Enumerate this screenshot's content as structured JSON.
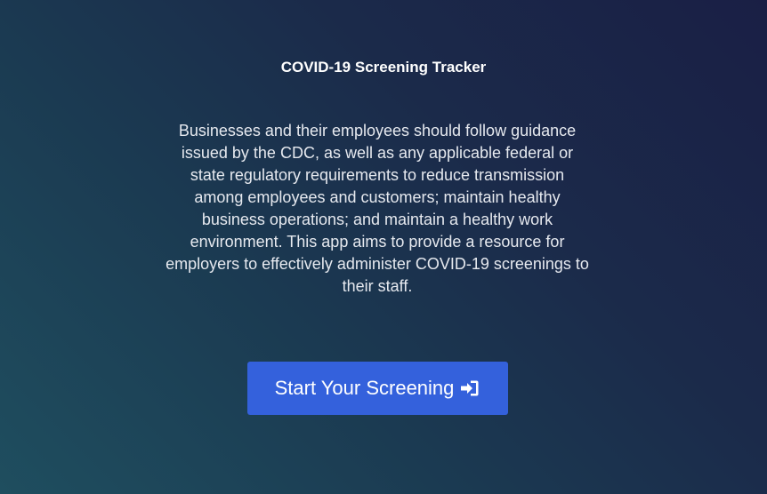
{
  "page": {
    "title": "COVID-19 Screening Tracker",
    "description": "Businesses and their employees should follow guidance issued by the CDC, as well as any applicable federal or state regulatory requirements to reduce transmission among employees and customers; maintain healthy business operations; and maintain a healthy work environment. This app aims to provide a resource for employers to effectively administer COVID-19 screenings to their staff."
  },
  "start_button": {
    "label": "Start Your Screening",
    "icon": "sign-in-icon",
    "color": "#3461dc"
  },
  "colors": {
    "background_start": "#1f4e5f",
    "background_end": "#1a1f45",
    "text": "#ffffff"
  }
}
